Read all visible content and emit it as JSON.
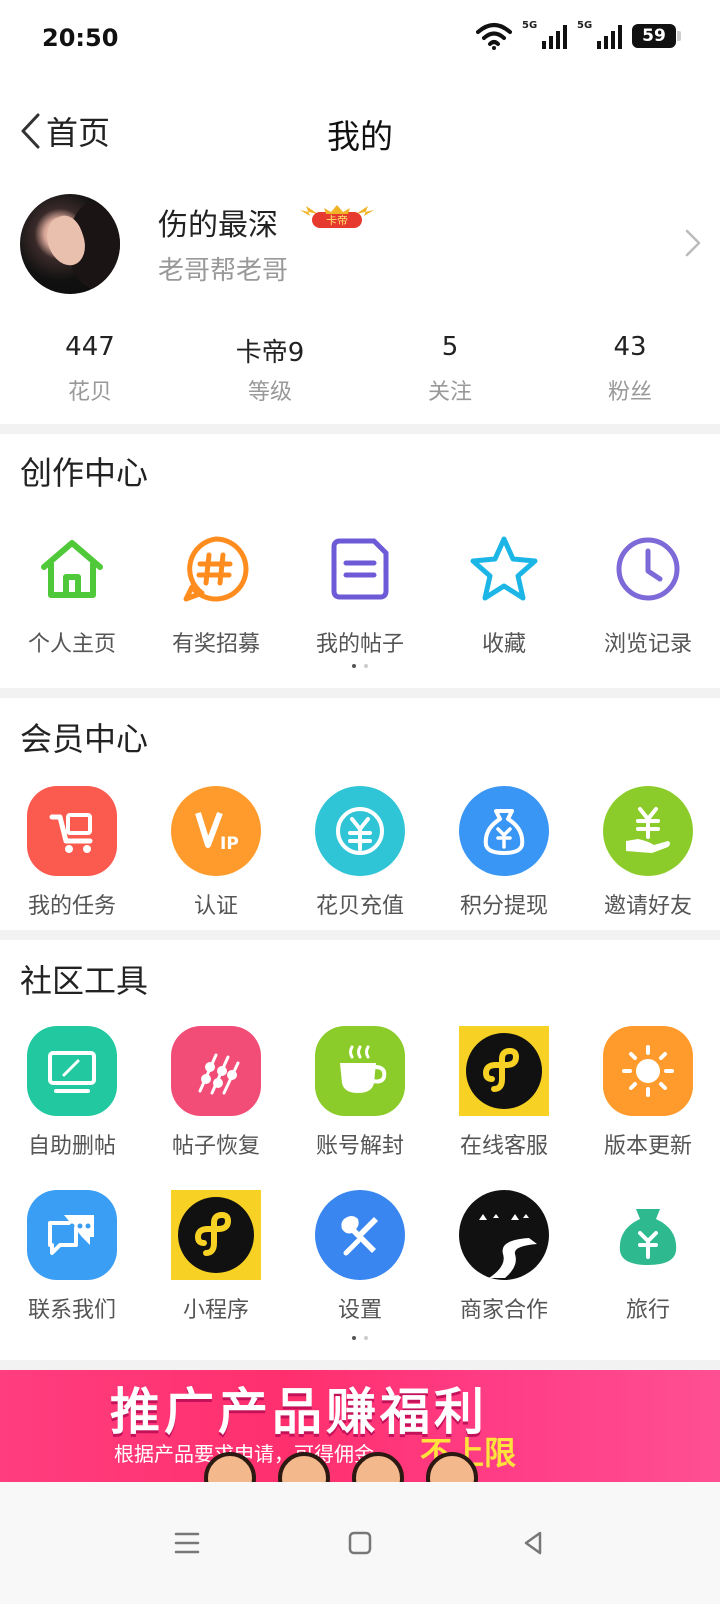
{
  "status": {
    "time": "20:50",
    "signal1": "5G",
    "signal2": "5G",
    "battery": "59"
  },
  "nav": {
    "back_label": "首页",
    "title": "我的"
  },
  "profile": {
    "username": "伤的最深",
    "badge": "卡帝",
    "subtitle": "老哥帮老哥"
  },
  "stats": [
    {
      "value": "447",
      "label": "花贝"
    },
    {
      "value": "卡帝9",
      "label": "等级"
    },
    {
      "value": "5",
      "label": "关注"
    },
    {
      "value": "43",
      "label": "粉丝"
    }
  ],
  "creation": {
    "title": "创作中心",
    "items": [
      {
        "label": "个人主页",
        "icon": "home-icon"
      },
      {
        "label": "有奖招募",
        "icon": "hashtag-icon"
      },
      {
        "label": "我的帖子",
        "icon": "document-icon"
      },
      {
        "label": "收藏",
        "icon": "star-icon"
      },
      {
        "label": "浏览记录",
        "icon": "clock-icon"
      }
    ]
  },
  "member": {
    "title": "会员中心",
    "items": [
      {
        "label": "我的任务",
        "icon": "task-icon",
        "color": "#fb5a4e"
      },
      {
        "label": "认证",
        "icon": "vip-icon",
        "color": "#ff9b2c"
      },
      {
        "label": "花贝充值",
        "icon": "recharge-icon",
        "color": "#2fc4d6"
      },
      {
        "label": "积分提现",
        "icon": "money-bag-icon",
        "color": "#3a96f5"
      },
      {
        "label": "邀请好友",
        "icon": "invite-icon",
        "color": "#8ccc2a"
      }
    ]
  },
  "tools": {
    "title": "社区工具",
    "items": [
      {
        "label": "自助删帖",
        "icon": "monitor-icon",
        "color": "#22c9a0"
      },
      {
        "label": "帖子恢复",
        "icon": "skewer-icon",
        "color": "#f24d77"
      },
      {
        "label": "账号解封",
        "icon": "cup-icon",
        "color": "#8ccc2a"
      },
      {
        "label": "在线客服",
        "icon": "mini-program-icon",
        "color": "#f7d224"
      },
      {
        "label": "版本更新",
        "icon": "sun-icon",
        "color": "#ff9b2c"
      },
      {
        "label": "联系我们",
        "icon": "chat-icon",
        "color": "#3a9ef5"
      },
      {
        "label": "小程序",
        "icon": "mini-program-icon",
        "color": "#f7d224"
      },
      {
        "label": "设置",
        "icon": "tools-icon",
        "color": "#3a86f0"
      },
      {
        "label": "商家合作",
        "icon": "merchant-icon",
        "color": "#111111"
      },
      {
        "label": "旅行",
        "icon": "money-bag-icon",
        "color": "#2fb98e"
      }
    ]
  },
  "banner": {
    "headline": "推广产品赚福利",
    "subline": "根据产品要求申请，可得佣金",
    "highlight": "不上限"
  }
}
